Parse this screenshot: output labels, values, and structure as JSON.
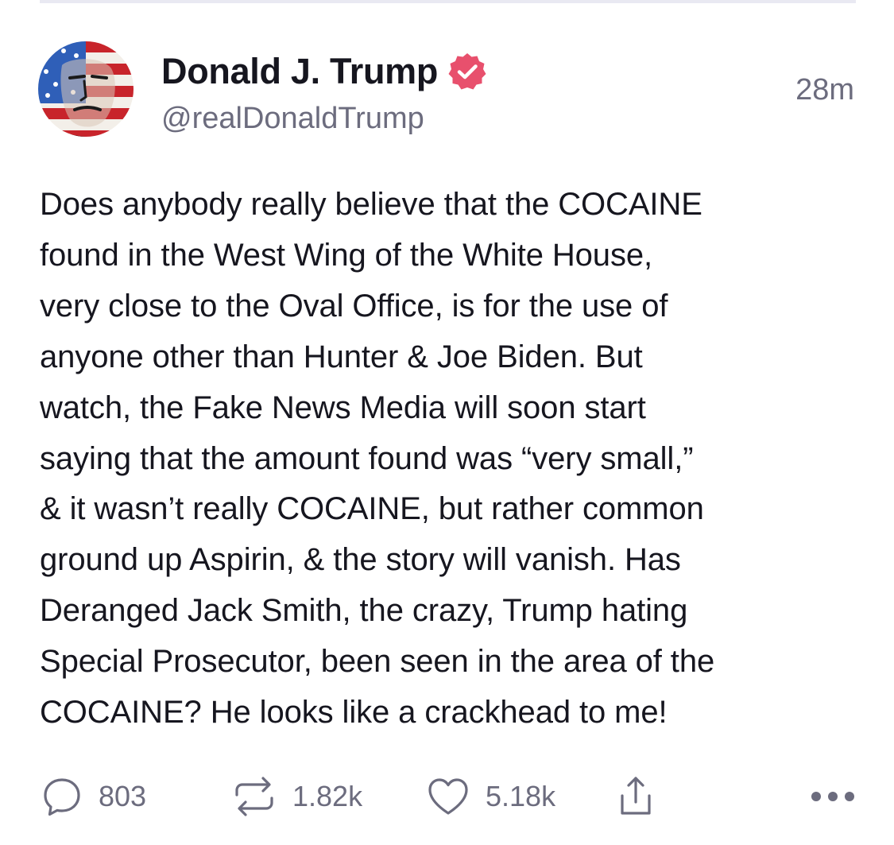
{
  "post": {
    "author": {
      "display_name": "Donald J. Trump",
      "handle": "@realDonaldTrump",
      "verified": true,
      "avatar": "avatar-flag-portrait"
    },
    "timestamp": "28m",
    "body_lines": [
      "Does anybody really believe that the COCAINE",
      "found in the West Wing of the White House,",
      "very close to the Oval Office, is for the use of",
      "anyone other than Hunter & Joe Biden. But",
      "watch, the Fake News Media will soon start",
      "saying that the amount found was “very small,”",
      "& it wasn’t really COCAINE, but rather common",
      "ground up Aspirin, & the story will vanish. Has",
      "Deranged Jack Smith, the crazy, Trump hating",
      "Special Prosecutor, been seen in the area of the",
      "COCAINE? He looks like a crackhead to me!"
    ],
    "actions": {
      "replies": "803",
      "retruths": "1.82k",
      "likes": "5.18k"
    }
  },
  "icons": {
    "verified": "verified-badge-icon",
    "reply": "reply-bubble-icon",
    "retruth": "retruth-arrows-icon",
    "like": "heart-icon",
    "share": "share-upload-icon",
    "more": "more-dots-icon"
  },
  "colors": {
    "text": "#16161f",
    "muted": "#6c6c7e",
    "verified_badge": "#e8506d",
    "divider": "#e9e9f2",
    "background": "#ffffff"
  }
}
